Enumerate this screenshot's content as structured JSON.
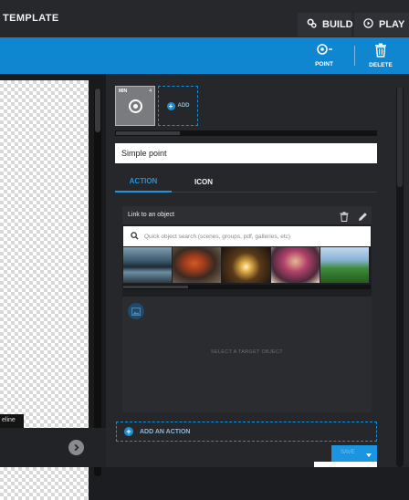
{
  "topbar": {
    "title": "TEMPLATE",
    "build_label": "BUILD",
    "play_label": "PLAY",
    "build_icon": "gears-icon",
    "play_icon": "play-circle-icon"
  },
  "toolbar": {
    "point_label": "POINT",
    "delete_label": "DELETE",
    "point_icon": "target-icon",
    "delete_icon": "trash-icon",
    "accent_color": "#0f86cf"
  },
  "canvas": {
    "timeline_label": "eline"
  },
  "panel": {
    "thumb": {
      "corner_left": "MIN",
      "corner_right": "4"
    },
    "add_label": "ADD",
    "name_value": "Simple point",
    "tabs": [
      {
        "label": "ACTION",
        "active": true
      },
      {
        "label": "ICON",
        "active": false
      }
    ],
    "link": {
      "title": "Link to an object",
      "search_placeholder": "Quick object search (scenes, groups, pdf, galleries, etc)",
      "photos": [
        "lake-mountains",
        "hiker-orange",
        "tunnel-lights",
        "festival-women",
        "green-field"
      ],
      "target_text": "SELECT A TARGET OBJECT"
    },
    "add_action_label": "ADD AN ACTION",
    "save_label": "SAVE"
  }
}
